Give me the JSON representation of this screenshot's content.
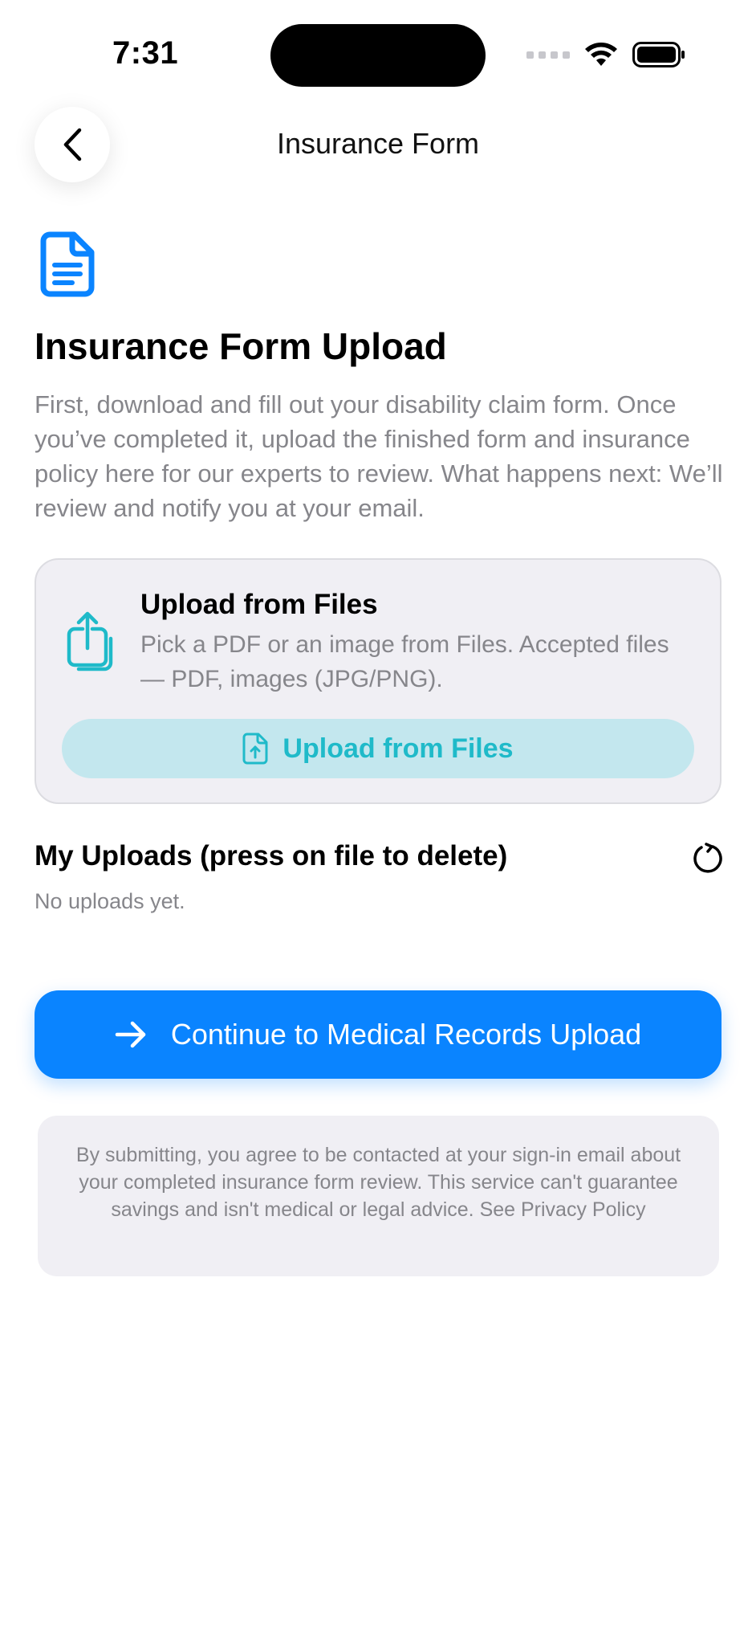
{
  "status_bar": {
    "time": "7:31"
  },
  "header": {
    "title": "Insurance Form"
  },
  "intro": {
    "title": "Insurance Form Upload",
    "description": "First, download and fill out your disability claim form. Once you’ve completed it, upload the finished form and insurance policy here for our experts to review. What happens next: We’ll review and notify you at your email."
  },
  "upload_card": {
    "title": "Upload from Files",
    "description": "Pick a PDF or an image from Files. Accepted files — PDF, images (JPG/PNG).",
    "button_label": "Upload from Files"
  },
  "my_uploads": {
    "title": "My Uploads (press on file to delete)",
    "empty_text": "No uploads yet."
  },
  "continue_button": {
    "label": "Continue to Medical Records Upload"
  },
  "disclaimer": {
    "text": "By submitting, you agree to be contacted at your sign-in email about your completed insurance form review. This service can't guarantee savings and isn't medical or legal advice. See Privacy Policy"
  },
  "icons": {
    "back": "chevron-left-icon",
    "document": "document-text-icon",
    "share": "share-upload-icon",
    "file_upload": "file-upload-icon",
    "refresh": "refresh-icon",
    "arrow": "arrow-right-icon"
  },
  "colors": {
    "primary_blue": "#0a84ff",
    "accent_teal": "#1fbac9",
    "teal_button_bg": "#c3e7ee",
    "card_bg": "#f0eff4",
    "secondary_text": "#86868b"
  }
}
